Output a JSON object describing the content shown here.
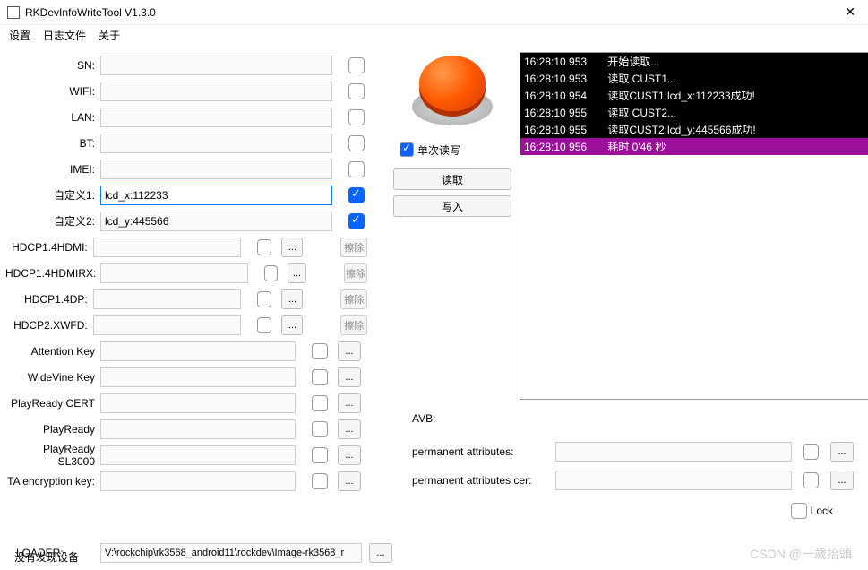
{
  "window": {
    "title": "RKDevInfoWriteTool V1.3.0",
    "close": "✕"
  },
  "menu": {
    "settings": "设置",
    "log": "日志文件",
    "about": "关于"
  },
  "fields": [
    {
      "label": "SN:",
      "value": "",
      "checked": false,
      "hdcp": false
    },
    {
      "label": "WIFI:",
      "value": "",
      "checked": false,
      "hdcp": false
    },
    {
      "label": "LAN:",
      "value": "",
      "checked": false,
      "hdcp": false
    },
    {
      "label": "BT:",
      "value": "",
      "checked": false,
      "hdcp": false
    },
    {
      "label": "IMEI:",
      "value": "",
      "checked": false,
      "hdcp": false
    },
    {
      "label": "自定义1:",
      "value": "lcd_x:112233",
      "checked": true,
      "focus": true,
      "hdcp": false
    },
    {
      "label": "自定义2:",
      "value": "lcd_y:445566",
      "checked": true,
      "hdcp": false
    },
    {
      "label": "HDCP1.4HDMI:",
      "value": "",
      "checked": false,
      "hdcp": true,
      "del": "擦除"
    },
    {
      "label": "HDCP1.4HDMIRX:",
      "value": "",
      "checked": false,
      "hdcp": true,
      "del": "擦除"
    },
    {
      "label": "HDCP1.4DP:",
      "value": "",
      "checked": false,
      "hdcp": true,
      "del": "擦除"
    },
    {
      "label": "HDCP2.XWFD:",
      "value": "",
      "checked": false,
      "hdcp": true,
      "del": "擦除"
    },
    {
      "label": "Attention Key",
      "value": "",
      "checked": false,
      "hdcp": true
    },
    {
      "label": "WideVine Key",
      "value": "",
      "checked": false,
      "hdcp": true
    },
    {
      "label": "PlayReady CERT",
      "value": "",
      "checked": false,
      "hdcp": true
    },
    {
      "label": "PlayReady",
      "value": "",
      "checked": false,
      "hdcp": true
    },
    {
      "label": "PlayReady SL3000",
      "value": "",
      "checked": false,
      "hdcp": true
    },
    {
      "label": "TA encryption key:",
      "value": "",
      "checked": false,
      "hdcp": true
    }
  ],
  "loader": {
    "label": "LOADER:",
    "value": "V:\\rockchip\\rk3568_android11\\rockdev\\Image-rk3568_r"
  },
  "status": "没有发现设备",
  "controls": {
    "single": "单次读写",
    "read": "读取",
    "write": "写入",
    "dots": "..."
  },
  "logLines": [
    {
      "ts": "16:28:10 953",
      "msg": "开始读取...",
      "hl": false
    },
    {
      "ts": "16:28:10 953",
      "msg": "读取 CUST1...",
      "hl": false
    },
    {
      "ts": "16:28:10 954",
      "msg": "读取CUST1:lcd_x:112233成功!",
      "hl": false
    },
    {
      "ts": "16:28:10 955",
      "msg": "读取 CUST2...",
      "hl": false
    },
    {
      "ts": "16:28:10 955",
      "msg": "读取CUST2:lcd_y:445566成功!",
      "hl": false
    },
    {
      "ts": "16:28:10 956",
      "msg": "耗时 0'46 秒",
      "hl": true
    }
  ],
  "avb": {
    "title": "AVB:",
    "rows": [
      {
        "label": "permanent attributes:"
      },
      {
        "label": "permanent attributes cer:"
      }
    ],
    "lock": "Lock"
  },
  "watermark": "CSDN @一歲抬頭"
}
